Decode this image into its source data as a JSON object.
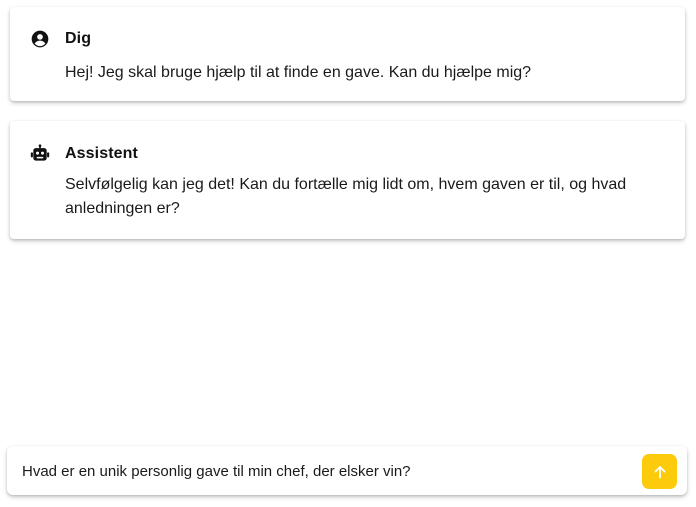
{
  "messages": [
    {
      "sender": "Dig",
      "icon": "user-circle-icon",
      "text": "Hej! Jeg skal bruge hjælp til at finde en gave. Kan du hjælpe mig?"
    },
    {
      "sender": "Assistent",
      "icon": "robot-icon",
      "text": "Selvfølgelig kan jeg det! Kan du fortælle mig lidt om, hvem gaven er til, og hvad anledningen er?"
    }
  ],
  "composer": {
    "value": "Hvad er en unik personlig gave til min chef, der elsker vin?",
    "send_icon": "arrow-up-icon",
    "accent_color": "#fccb0b"
  }
}
